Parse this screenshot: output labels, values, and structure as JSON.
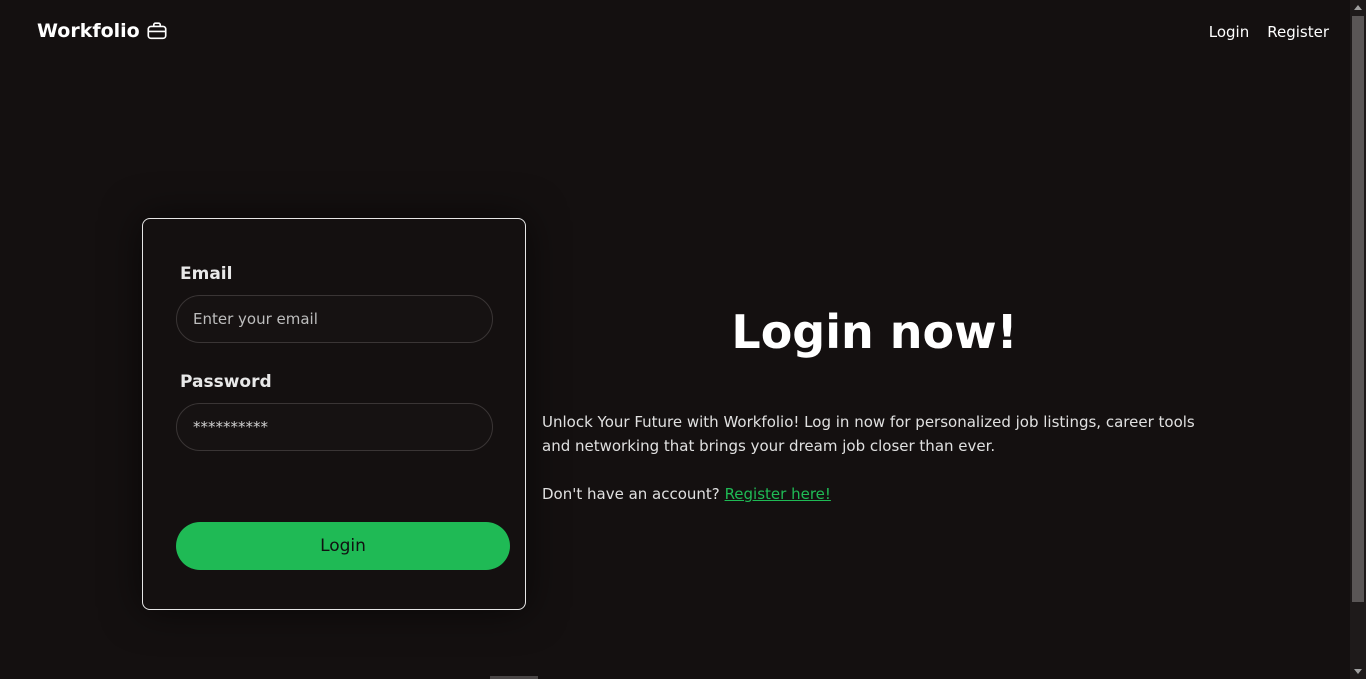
{
  "navbar": {
    "brand": "Workfolio",
    "brand_icon": "briefcase-icon",
    "links": [
      "Login",
      "Register"
    ]
  },
  "form": {
    "email_label": "Email",
    "email_placeholder": "Enter your email",
    "password_label": "Password",
    "password_value": "**********",
    "submit_label": "Login"
  },
  "hero": {
    "title": "Login now!",
    "description": "Unlock Your Future with Workfolio! Log in now for personalized job listings, career tools and networking that brings your dream job closer than ever.",
    "signup_prompt": "Don't have an account?",
    "signup_link": "Register here!"
  },
  "colors": {
    "background": "#141010",
    "accent": "#1fba55",
    "text": "#ffffff"
  }
}
